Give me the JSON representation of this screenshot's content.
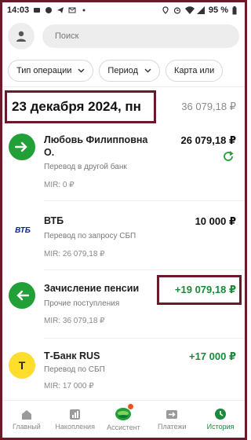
{
  "statusbar": {
    "time": "14:03",
    "battery": "95 %"
  },
  "search": {
    "placeholder": "Поиск"
  },
  "filters": [
    {
      "label": "Тип операции"
    },
    {
      "label": "Период"
    },
    {
      "label": "Карта или"
    }
  ],
  "day": {
    "date": "23 декабря 2024, пн",
    "total": "36 079,18 ₽"
  },
  "transactions": [
    {
      "name_line1": "Любовь Филипповна",
      "name_line2": "О.",
      "subtitle": "Перевод в другой банк",
      "card": "MIR: 0 ₽",
      "amount": "26 079,18 ₽",
      "icon": "arrow-right-icon",
      "icon_color": "#21a038"
    },
    {
      "name_line1": "ВТБ",
      "name_line2": "",
      "subtitle": "Перевод по запросу СБП",
      "card": "MIR: 26 079,18 ₽",
      "amount": "10 000 ₽",
      "icon": "vtb-logo",
      "icon_color": "#0a2896",
      "logo_text": "ВТБ"
    },
    {
      "name_line1": "Зачисление пенсии",
      "name_line2": "",
      "subtitle": "Прочие поступления",
      "card": "MIR: 36 079,18 ₽",
      "amount": "+19 079,18 ₽",
      "icon": "arrow-left-icon",
      "icon_color": "#21a038"
    },
    {
      "name_line1": "Т-Банк RUS",
      "name_line2": "",
      "subtitle": "Перевод по СБП",
      "card": "MIR: 17 000 ₽",
      "amount": "+17 000 ₽",
      "icon": "tbank-logo",
      "icon_color": "#ffdd2d",
      "logo_text": "Т"
    }
  ],
  "tabs": [
    {
      "label": "Главный",
      "icon": "home-icon"
    },
    {
      "label": "Накопления",
      "icon": "savings-icon"
    },
    {
      "label": "Ассистент",
      "icon": "assistant-icon"
    },
    {
      "label": "Платежи",
      "icon": "payments-icon"
    },
    {
      "label": "История",
      "icon": "history-icon"
    }
  ],
  "colors": {
    "accent_green": "#21a038",
    "highlight_frame": "#6b1a2a"
  }
}
